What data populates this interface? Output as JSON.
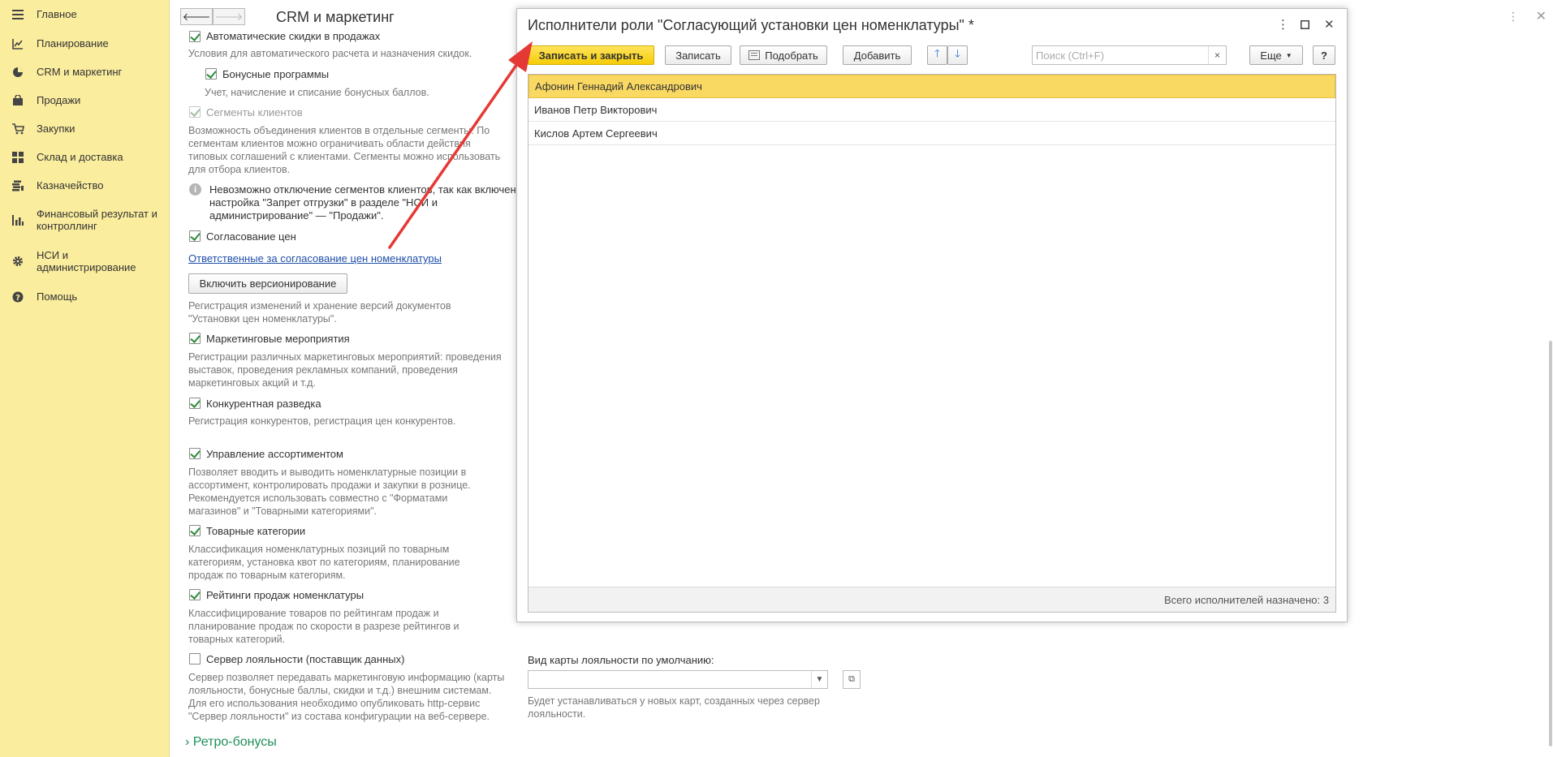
{
  "sidebar": {
    "items": [
      {
        "label": "Главное",
        "icon": "menu-icon"
      },
      {
        "label": "Планирование",
        "icon": "chart-line-icon"
      },
      {
        "label": "CRM и маркетинг",
        "icon": "pie-chart-icon"
      },
      {
        "label": "Продажи",
        "icon": "shopping-bag-icon"
      },
      {
        "label": "Закупки",
        "icon": "cart-icon"
      },
      {
        "label": "Склад и доставка",
        "icon": "grid-icon"
      },
      {
        "label": "Казначейство",
        "icon": "coins-icon"
      },
      {
        "label": "Финансовый результат и контроллинг",
        "icon": "bar-chart-icon"
      },
      {
        "label": "НСИ и администрирование",
        "icon": "gear-icon"
      },
      {
        "label": "Помощь",
        "icon": "help-icon"
      }
    ]
  },
  "main": {
    "title": "CRM и маркетинг",
    "auto_discounts_label": "Автоматические скидки в продажах",
    "auto_discounts_note": "Условия для автоматического расчета и назначения скидок.",
    "bonus_label": "Бонусные программы",
    "bonus_note": "Учет, начисление и списание бонусных баллов.",
    "segments_label": "Сегменты клиентов",
    "segments_note_1": "Возможность объединения клиентов в отдельные сегменты. По",
    "segments_note_2": "сегментам клиентов можно ограничивать области действия",
    "segments_note_3": "типовых соглашений с клиентами. Сегменты можно использовать",
    "segments_note_4": "для отбора клиентов.",
    "info_1": "Невозможно отключение сегментов клиентов, так как включена",
    "info_2": "настройка \"Запрет отгрузки\" в разделе \"НСИ и",
    "info_3": "администрирование\" — \"Продажи\".",
    "price_approval_label": "Согласование цен",
    "responsible_link": "Ответственные за согласование цен номенклатуры",
    "versioning_button": "Включить версионирование",
    "versioning_note_1": "Регистрация изменений и хранение версий документов",
    "versioning_note_2": "\"Установки цен номенклатуры\".",
    "marketing_label": "Маркетинговые мероприятия",
    "marketing_note_1": "Регистрации различных маркетинговых мероприятий: проведения",
    "marketing_note_2": "выставок, проведения рекламных компаний, проведения",
    "marketing_note_3": "маркетинговых акций и т.д.",
    "competitors_label": "Конкурентная разведка",
    "competitors_note": "Регистрация конкурентов, регистрация цен конкурентов.",
    "assortment_label": "Управление ассортиментом",
    "assortment_note_1": "Позволяет вводить и выводить номенклатурные позиции в",
    "assortment_note_2": "ассортимент, контролировать продажи и закупки в рознице.",
    "assortment_note_3": "Рекомендуется использовать совместно с \"Форматами",
    "assortment_note_4": "магазинов\" и \"Товарными категориями\".",
    "categories_label": "Товарные категории",
    "categories_note_1": "Классификация номенклатурных позиций по товарным",
    "categories_note_2": "категориям, установка квот по категориям, планирование",
    "categories_note_3": "продаж по товарным категориям.",
    "ratings_label": "Рейтинги продаж номенклатуры",
    "ratings_note_1": "Классифицирование товаров по рейтингам продаж и",
    "ratings_note_2": "планирование продаж по скорости в разрезе рейтингов и",
    "ratings_note_3": "товарных категорий.",
    "loyalty_server_label": "Сервер лояльности (поставщик данных)",
    "loyalty_note_1": "Сервер позволяет передавать маркетинговую информацию (карты",
    "loyalty_note_2": "лояльности, бонусные баллы, скидки и т.д.) внешним системам.",
    "loyalty_note_3": "Для его использования необходимо опубликовать http-сервис",
    "loyalty_note_4": "\"Сервер лояльности\" из состава конфигурации на веб-сервере.",
    "card_type_label": "Вид карты лояльности по умолчанию:",
    "card_type_value": "",
    "card_type_note_1": "Будет устанавливаться у новых карт, созданных через сервер",
    "card_type_note_2": "лояльности.",
    "retro_label": "Ретро-бонусы"
  },
  "modal": {
    "title": "Исполнители роли \"Согласующий установки цен номенклатуры\" *",
    "save_close": "Записать и закрыть",
    "save": "Записать",
    "pick": "Подобрать",
    "add": "Добавить",
    "more": "Еще",
    "help": "?",
    "search_placeholder": "Поиск (Ctrl+F)",
    "search_value": "",
    "rows": [
      "Афонин Геннадий Александрович",
      "Иванов Петр Викторович",
      "Кислов Артем Сергеевич"
    ],
    "footer": "Всего исполнителей назначено: 3"
  },
  "colors": {
    "sidebar_bg": "#fbed9e",
    "primary_button": "#f5cc07",
    "selected_row": "#fad963",
    "arrow": "#e53935",
    "link": "#1f4fa8",
    "check": "#2e8b3a"
  }
}
